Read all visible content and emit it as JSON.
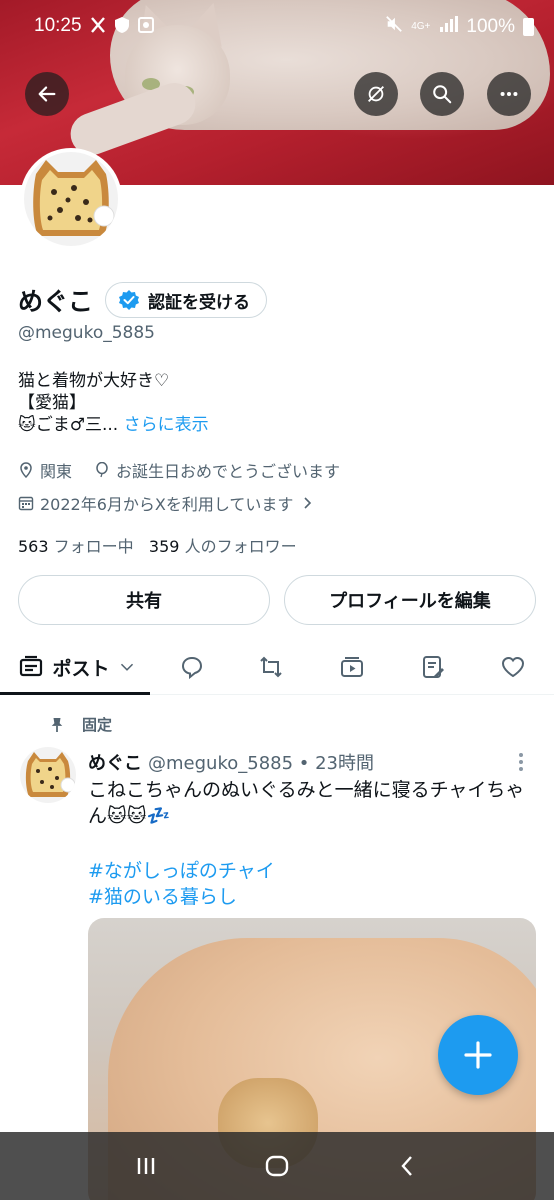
{
  "status_bar": {
    "time": "10:25",
    "network": "4G+",
    "battery": "100%"
  },
  "profile": {
    "display_name": "めぐこ",
    "verify_label": "認証を受ける",
    "handle": "@meguko_5885",
    "bio_line1": "猫と着物が大好き♡",
    "bio_line2": "【愛猫】",
    "bio_line3": "🐱ごま♂三...",
    "bio_more": "さらに表示",
    "location": "関東",
    "birthday": "お誕生日おめでとうございます",
    "joined": "2022年6月からXを利用しています",
    "following_count": "563",
    "following_label": "フォロー中",
    "followers_count": "359",
    "followers_label": "人のフォロワー"
  },
  "buttons": {
    "share": "共有",
    "edit_profile": "プロフィールを編集"
  },
  "tabs": {
    "posts_label": "ポスト"
  },
  "tweet": {
    "pinned_label": "固定",
    "name": "めぐこ",
    "handle_time": "@meguko_5885 • 23時間",
    "text": "こねこちゃんのぬいぐるみと一緒に寝るチャイちゃん🐱🐱💤",
    "hashtag1": "#ながしっぽのチャイ",
    "hashtag2": "#猫のいる暮らし"
  },
  "colors": {
    "accent": "#1d9bf0",
    "text": "#0f1419",
    "muted": "#536471",
    "border": "#cfd9de"
  }
}
